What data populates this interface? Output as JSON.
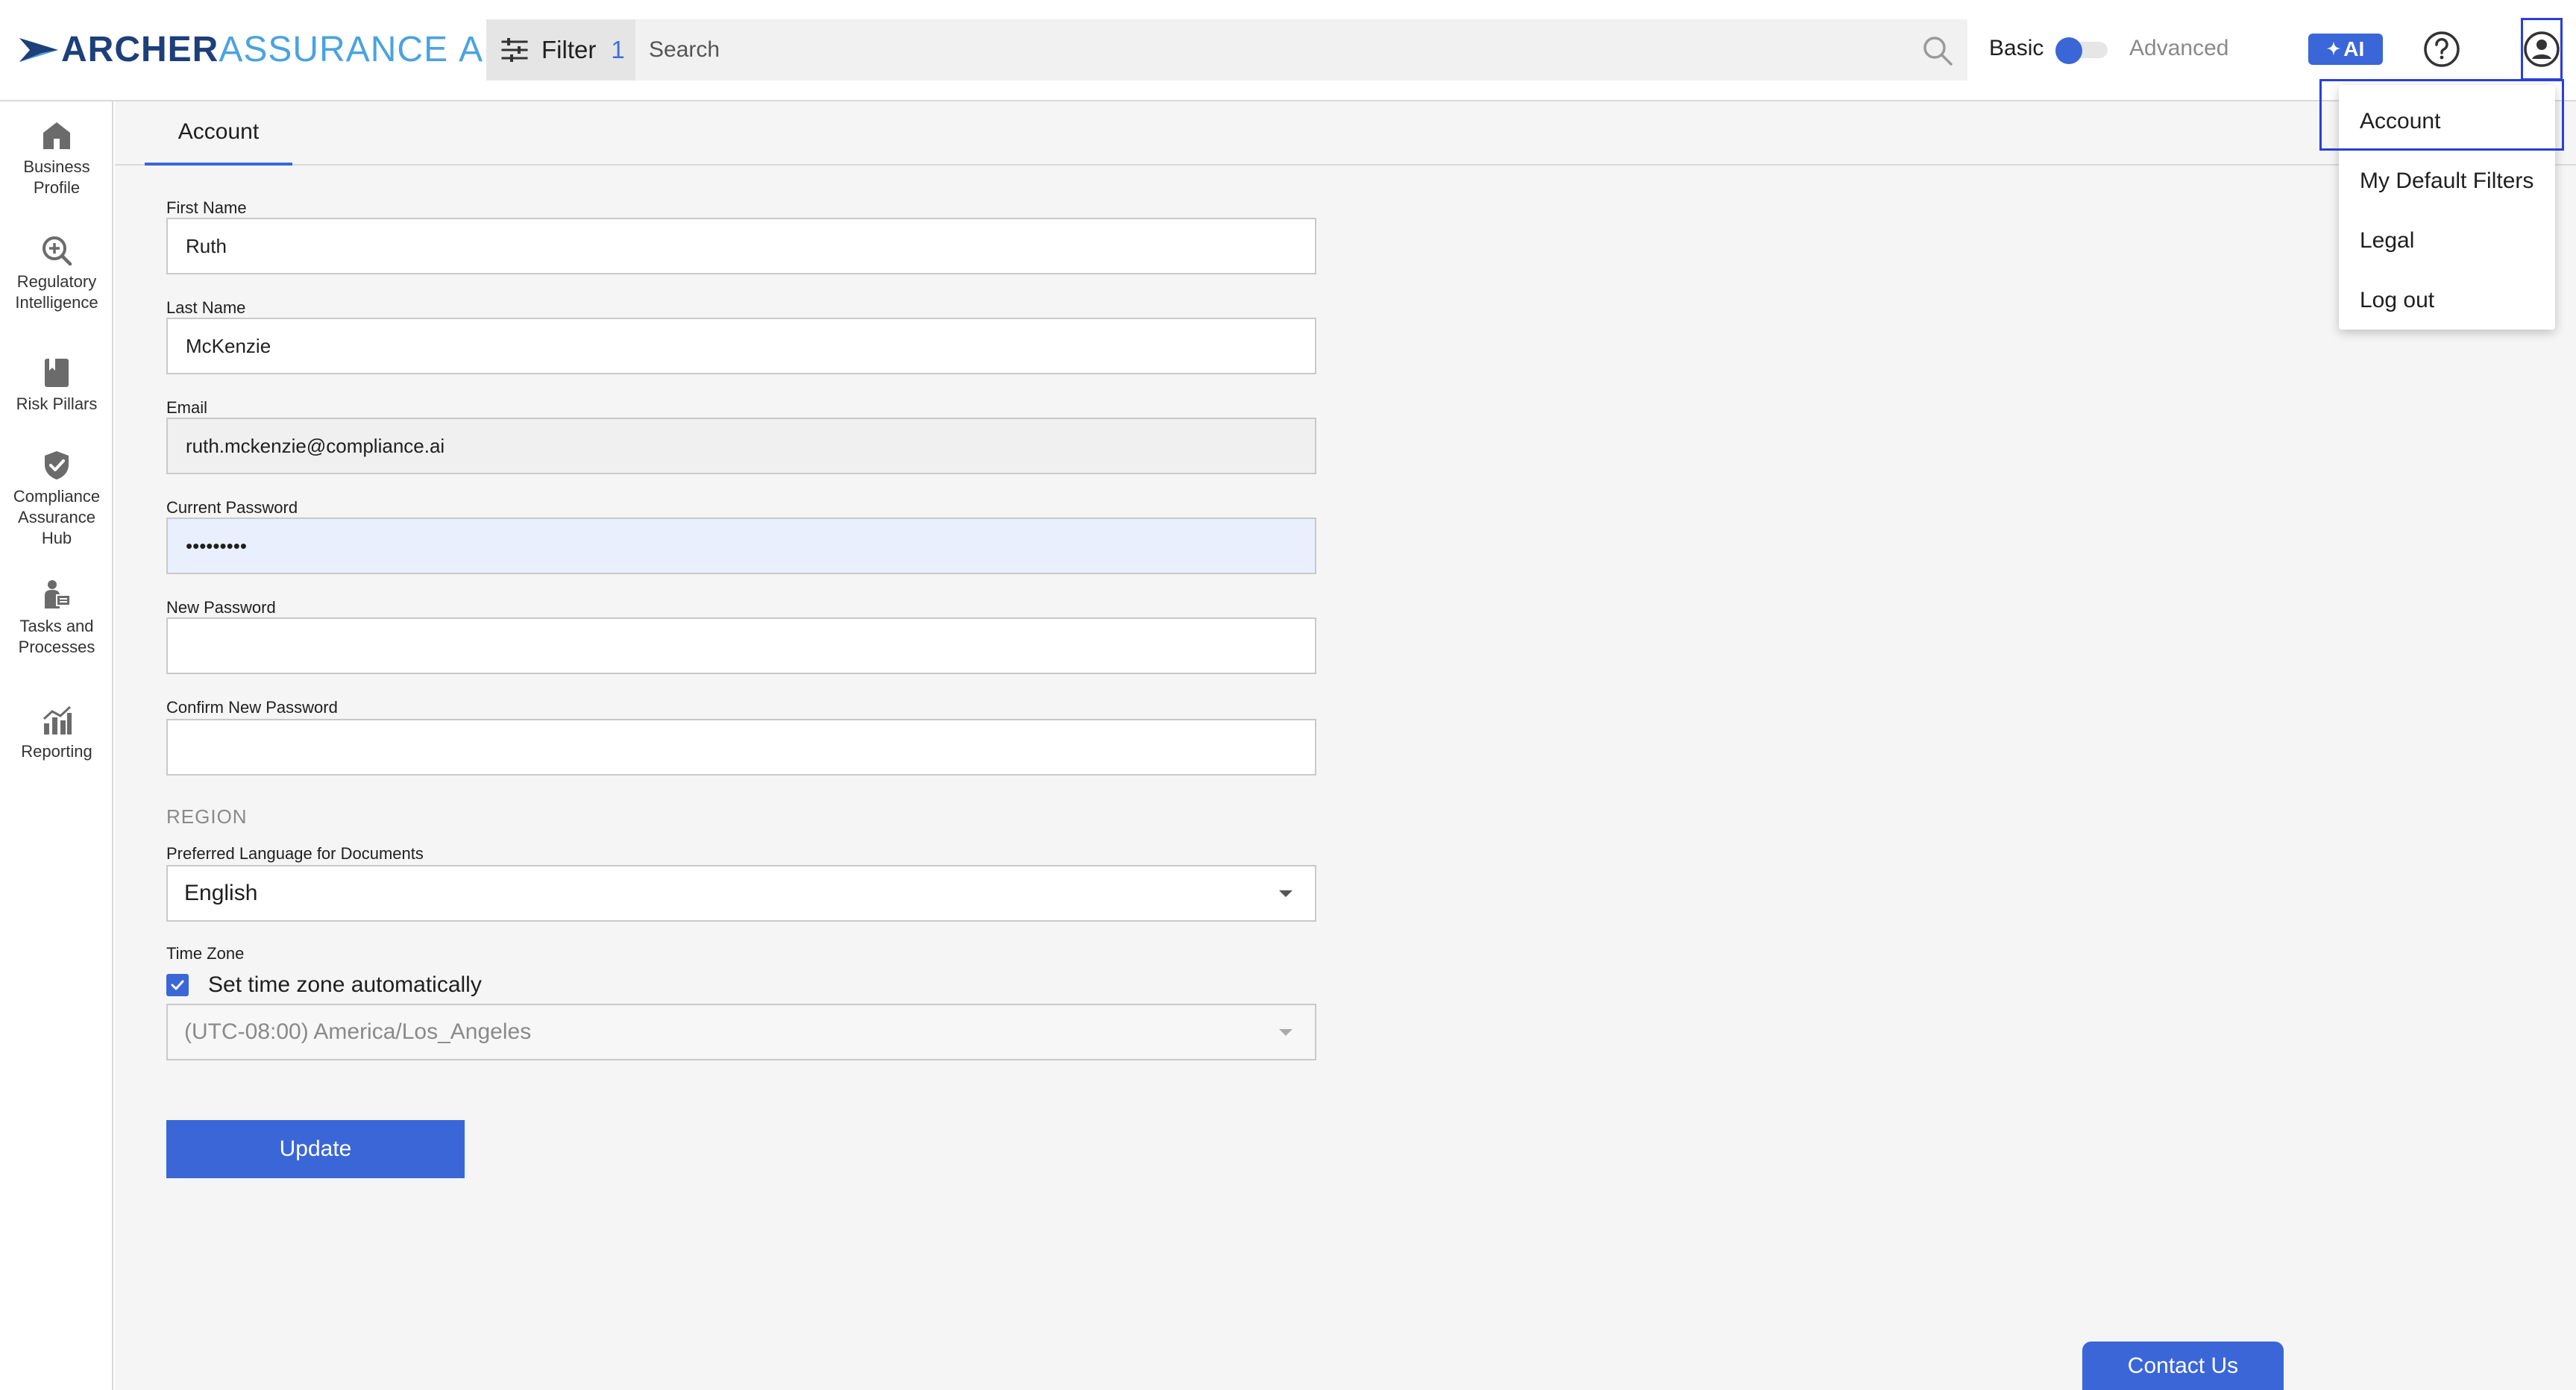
{
  "header": {
    "logo": {
      "strong": "ARCHER",
      "light": "ASSURANCE",
      "suffix": "AI"
    },
    "filter": {
      "label": "Filter",
      "count": "1"
    },
    "search": {
      "placeholder": "Search"
    },
    "mode": {
      "basic": "Basic",
      "advanced": "Advanced",
      "selected": "Basic"
    },
    "ai_button": {
      "label": "AI"
    }
  },
  "sidebar": {
    "items": [
      {
        "label_lines": [
          "Business",
          "Profile"
        ],
        "icon": "home-icon"
      },
      {
        "label_lines": [
          "Regulatory",
          "Intelligence"
        ],
        "icon": "search-plus-icon"
      },
      {
        "label_lines": [
          "Risk Pillars"
        ],
        "icon": "book-icon"
      },
      {
        "label_lines": [
          "Compliance",
          "Assurance",
          "Hub"
        ],
        "icon": "shield-check-icon"
      },
      {
        "label_lines": [
          "Tasks and",
          "Processes"
        ],
        "icon": "person-task-icon"
      },
      {
        "label_lines": [
          "Reporting"
        ],
        "icon": "chart-icon"
      }
    ]
  },
  "tabs": {
    "account": "Account"
  },
  "form": {
    "first_name": {
      "label": "First Name",
      "value": "Ruth"
    },
    "last_name": {
      "label": "Last Name",
      "value": "McKenzie"
    },
    "email": {
      "label": "Email",
      "value": "ruth.mckenzie@compliance.ai"
    },
    "current_password": {
      "label": "Current Password",
      "value": "•••••••••"
    },
    "new_password": {
      "label": "New Password",
      "value": ""
    },
    "confirm_password": {
      "label": "Confirm New Password",
      "value": ""
    },
    "region_heading": "REGION",
    "language": {
      "label": "Preferred Language for Documents",
      "value": "English"
    },
    "time_zone": {
      "label": "Time Zone",
      "auto_label": "Set time zone automatically",
      "auto_checked": true,
      "value": "(UTC-08:00) America/Los_Angeles"
    },
    "update_button": "Update"
  },
  "contact_button": "Contact Us",
  "user_menu": {
    "items": [
      "Account",
      "My Default Filters",
      "Legal",
      "Log out"
    ],
    "highlighted": "Account"
  },
  "colors": {
    "accent": "#3a66d8",
    "logo_dark": "#1d3f7a",
    "logo_light": "#4aa3df",
    "highlight_border": "#2a3fd9"
  }
}
